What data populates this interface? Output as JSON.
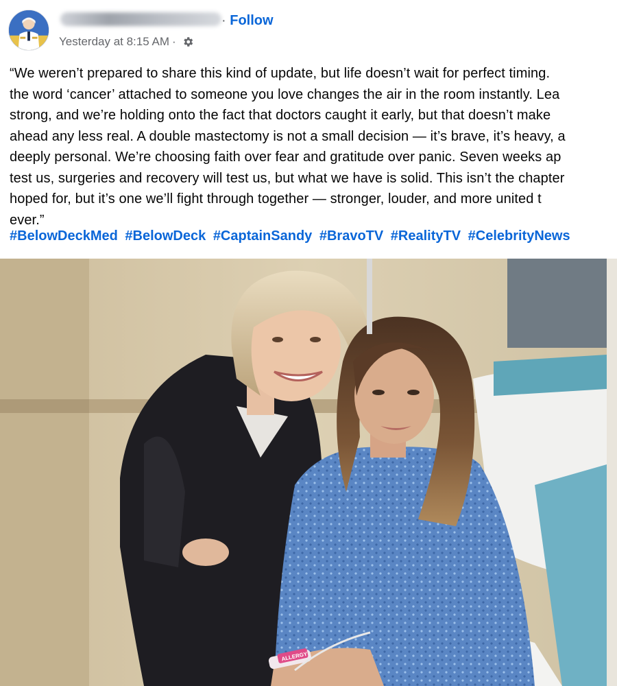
{
  "post": {
    "author_name_redacted": true,
    "separator": "·",
    "follow_label": "Follow",
    "timestamp": "Yesterday at 8:15 AM",
    "meta_separator": "·",
    "audience_icon": "gear-icon",
    "text_lines": [
      "“We weren’t prepared to share this kind of update, but life doesn’t wait for perfect timing.",
      "the word ‘cancer’ attached to someone you love changes the air in the room instantly. Lea",
      "strong, and we’re holding onto the fact that doctors caught it early, but that doesn’t make",
      "ahead any less real. A double mastectomy is not a small decision — it’s brave, it’s heavy, a",
      "deeply personal. We’re choosing faith over fear and gratitude over panic. Seven weeks ap",
      "test us, surgeries and recovery will test us, but what we have is solid. This isn’t the chapter",
      "hoped for, but it’s one we’ll fight through together — stronger, louder, and more united t",
      "ever.”"
    ],
    "hashtags": [
      "#BelowDeckMed",
      "#BelowDeck",
      "#CaptainSandy",
      "#BravoTV",
      "#RealityTV",
      "#CelebrityNews"
    ],
    "wristband_text": "ALLERGY"
  },
  "colors": {
    "link": "#0a66d8",
    "meta": "#65676b",
    "text": "#050505"
  }
}
